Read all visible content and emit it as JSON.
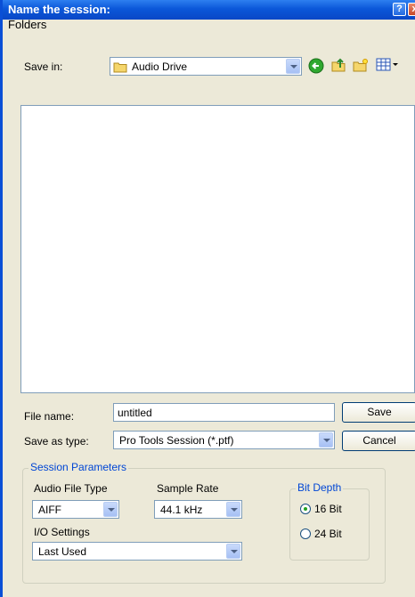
{
  "window": {
    "title": "Name the session:",
    "help_glyph": "?",
    "close_glyph": "x"
  },
  "menu": {
    "folders": "Folders"
  },
  "save_in": {
    "label": "Save in:",
    "value": "Audio Drive"
  },
  "toolbar": {
    "icons": [
      "back-icon",
      "up-folder-icon",
      "new-folder-icon",
      "view-menu-icon"
    ]
  },
  "file_name": {
    "label": "File name:",
    "value": "untitled"
  },
  "save_as_type": {
    "label": "Save as type:",
    "value": "Pro Tools Session (*.ptf)"
  },
  "buttons": {
    "save": "Save",
    "cancel": "Cancel"
  },
  "session_parameters": {
    "legend": "Session Parameters",
    "audio_file_type": {
      "label": "Audio File Type",
      "value": "AIFF"
    },
    "sample_rate": {
      "label": "Sample Rate",
      "value": "44.1 kHz"
    },
    "io_settings": {
      "label": "I/O Settings",
      "value": "Last Used"
    },
    "bit_depth": {
      "legend": "Bit Depth",
      "options": [
        {
          "label": "16 Bit",
          "selected": true
        },
        {
          "label": "24 Bit",
          "selected": false
        }
      ]
    }
  },
  "colors": {
    "titlebar": "#0b57d9",
    "dialog_bg": "#ece9d8",
    "group_legend": "#0046d5"
  }
}
